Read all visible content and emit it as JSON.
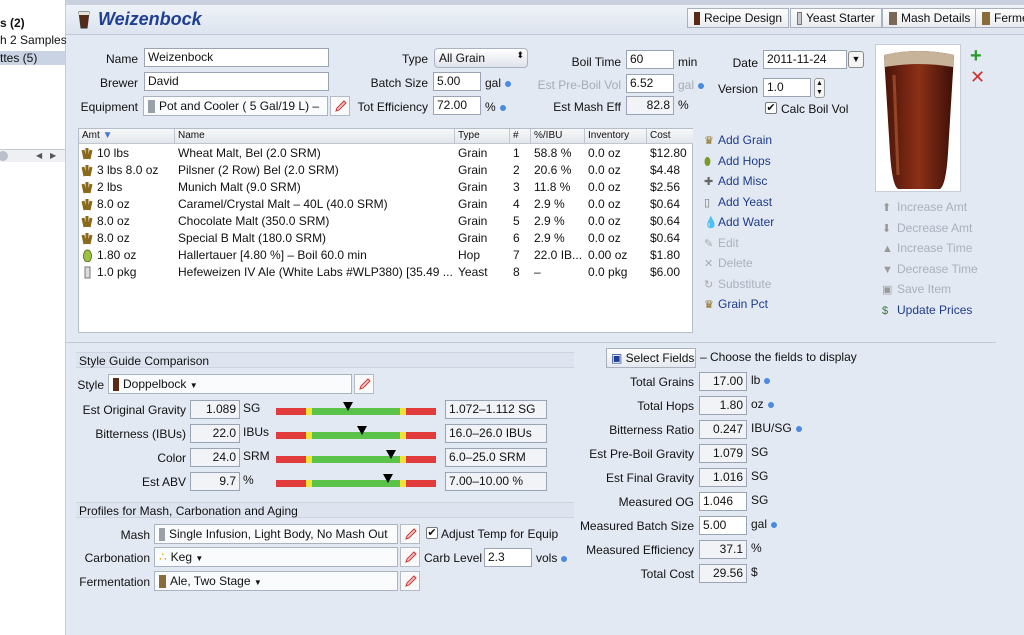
{
  "sidebar": {
    "items": [
      {
        "label": "s (2)"
      },
      {
        "label": "h 2 Samples"
      },
      {
        "label": "ttes (5)"
      }
    ]
  },
  "recipe": {
    "title": "Weizenbock",
    "toolbar": [
      "Recipe Design",
      "Yeast Starter",
      "Mash Details",
      "Ferme"
    ]
  },
  "form": {
    "name_label": "Name",
    "name_value": "Weizenbock",
    "brewer_label": "Brewer",
    "brewer_value": "David",
    "equipment_label": "Equipment",
    "equipment_value": "Pot and Cooler ( 5 Gal/19 L) –",
    "type_label": "Type",
    "type_value": "All Grain",
    "batch_label": "Batch Size",
    "batch_value": "5.00",
    "batch_unit": "gal",
    "eff_label": "Tot Efficiency",
    "eff_value": "72.00",
    "eff_unit": "%",
    "boil_label": "Boil Time",
    "boil_value": "60",
    "boil_unit": "min",
    "preboil_label": "Est Pre-Boil Vol",
    "preboil_value": "6.52",
    "preboil_unit": "gal",
    "mash_eff_label": "Est Mash Eff",
    "mash_eff_value": "82.8",
    "mash_eff_unit": "%",
    "date_label": "Date",
    "date_value": "2011-11-24",
    "version_label": "Version",
    "version_value": "1.0",
    "calc_boil_label": "Calc Boil Vol",
    "calc_boil_checked": true
  },
  "grid": {
    "headers": [
      "Amt",
      "Name",
      "Type",
      "#",
      "%/IBU",
      "Inventory",
      "Cost"
    ],
    "rows": [
      {
        "amt": "10 lbs",
        "name": "Wheat Malt, Bel (2.0 SRM)",
        "type": "Grain",
        "num": "1",
        "pct": "58.8 %",
        "inv": "0.0 oz",
        "cost": "$12.80",
        "icon": "grain-icon"
      },
      {
        "amt": "3 lbs 8.0 oz",
        "name": "Pilsner (2 Row) Bel (2.0 SRM)",
        "type": "Grain",
        "num": "2",
        "pct": "20.6 %",
        "inv": "0.0 oz",
        "cost": "$4.48",
        "icon": "grain-icon"
      },
      {
        "amt": "2 lbs",
        "name": "Munich Malt (9.0 SRM)",
        "type": "Grain",
        "num": "3",
        "pct": "11.8 %",
        "inv": "0.0 oz",
        "cost": "$2.56",
        "icon": "grain-icon"
      },
      {
        "amt": "8.0 oz",
        "name": "Caramel/Crystal Malt – 40L (40.0 SRM)",
        "type": "Grain",
        "num": "4",
        "pct": "2.9 %",
        "inv": "0.0 oz",
        "cost": "$0.64",
        "icon": "grain-icon"
      },
      {
        "amt": "8.0 oz",
        "name": "Chocolate Malt (350.0 SRM)",
        "type": "Grain",
        "num": "5",
        "pct": "2.9 %",
        "inv": "0.0 oz",
        "cost": "$0.64",
        "icon": "grain-icon"
      },
      {
        "amt": "8.0 oz",
        "name": "Special B Malt (180.0 SRM)",
        "type": "Grain",
        "num": "6",
        "pct": "2.9 %",
        "inv": "0.0 oz",
        "cost": "$0.64",
        "icon": "grain-icon"
      },
      {
        "amt": "1.80 oz",
        "name": "Hallertauer [4.80 %] – Boil 60.0 min",
        "type": "Hop",
        "num": "7",
        "pct": "22.0 IB...",
        "inv": "0.00 oz",
        "cost": "$1.80",
        "icon": "hop-icon"
      },
      {
        "amt": "1.0 pkg",
        "name": "Hefeweizen IV Ale (White Labs #WLP380) [35.49 ...",
        "type": "Yeast",
        "num": "8",
        "pct": "–",
        "inv": "0.0 pkg",
        "cost": "$6.00",
        "icon": "yeast-icon"
      }
    ]
  },
  "actions": {
    "left": [
      "Add Grain",
      "Add Hops",
      "Add Misc",
      "Add Yeast",
      "Add Water",
      "Edit",
      "Delete",
      "Substitute",
      "Grain Pct"
    ],
    "right": [
      "Increase Amt",
      "Decrease Amt",
      "Increase Time",
      "Decrease Time",
      "Save Item",
      "Update Prices"
    ]
  },
  "style_guide": {
    "section_title": "Style Guide Comparison",
    "style_label": "Style",
    "style_value": "Doppelbock",
    "rows": [
      {
        "label": "Est Original Gravity",
        "value": "1.089",
        "unit": "SG",
        "range": "1.072–1.112 SG",
        "level": 0.45
      },
      {
        "label": "Bitterness (IBUs)",
        "value": "22.0",
        "unit": "IBUs",
        "range": "16.0–26.0 IBUs",
        "level": 0.54
      },
      {
        "label": "Color",
        "value": "24.0",
        "unit": "SRM",
        "range": "6.0–25.0 SRM",
        "level": 0.72
      },
      {
        "label": "Est ABV",
        "value": "9.7",
        "unit": "%",
        "range": "7.00–10.00 %",
        "level": 0.7
      }
    ]
  },
  "profiles": {
    "section_title": "Profiles for Mash, Carbonation and Aging",
    "mash_label": "Mash",
    "mash_value": "Single Infusion, Light Body, No Mash Out",
    "adjust_temp_label": "Adjust Temp for Equip",
    "adjust_temp_checked": true,
    "carb_label": "Carbonation",
    "carb_value": "Keg",
    "carb_level_label": "Carb Level",
    "carb_level_value": "2.3",
    "carb_level_unit": "vols",
    "ferm_label": "Fermentation",
    "ferm_value": "Ale, Two Stage"
  },
  "stats": {
    "select_fields_label": "Select Fields",
    "select_fields_hint": "– Choose the fields to display",
    "rows": [
      {
        "label": "Total Grains",
        "value": "17.00",
        "unit": "lb"
      },
      {
        "label": "Total Hops",
        "value": "1.80",
        "unit": "oz"
      },
      {
        "label": "Bitterness Ratio",
        "value": "0.247",
        "unit": "IBU/SG"
      },
      {
        "label": "Est Pre-Boil Gravity",
        "value": "1.079",
        "unit": "SG"
      },
      {
        "label": "Est Final Gravity",
        "value": "1.016",
        "unit": "SG"
      },
      {
        "label": "Measured OG",
        "value": "1.046",
        "unit": "SG"
      },
      {
        "label": "Measured Batch Size",
        "value": "5.00",
        "unit": "gal"
      },
      {
        "label": "Measured Efficiency",
        "value": "37.1",
        "unit": "%"
      },
      {
        "label": "Total Cost",
        "value": "29.56",
        "unit": "$"
      }
    ]
  },
  "colors": {
    "accent": "#1f3f94",
    "bar_red": "#e23b3b",
    "bar_yellow": "#f2e23a",
    "bar_green": "#5bc24a",
    "beer": "#7a2a12"
  }
}
